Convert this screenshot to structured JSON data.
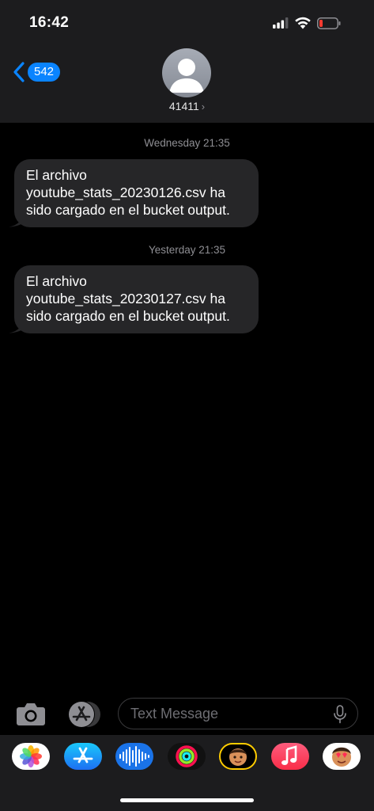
{
  "status_bar": {
    "time": "16:42"
  },
  "header": {
    "back_badge": "542",
    "contact_name": "41411",
    "contact_chevron": "›"
  },
  "conversation": [
    {
      "timestamp": "Wednesday 21:35",
      "lines": [
        "El archivo",
        "youtube_stats_20230126.csv ha",
        "sido cargado en el bucket output."
      ]
    },
    {
      "timestamp": "Yesterday 21:35",
      "lines": [
        "El archivo",
        "youtube_stats_20230127.csv ha",
        "sido cargado en el bucket output."
      ]
    }
  ],
  "composer": {
    "placeholder": "Text Message"
  },
  "app_drawer": [
    "photos-icon",
    "app-store-icon",
    "audio-message-icon",
    "activity-icon",
    "memoji-icon",
    "music-icon",
    "memoji-stickers-icon"
  ],
  "colors": {
    "accent": "#0a84ff",
    "header_bg": "#1c1c1e",
    "bubble_bg": "#262628",
    "timestamp": "#8e8e93",
    "battery_low": "#ff3b30"
  }
}
